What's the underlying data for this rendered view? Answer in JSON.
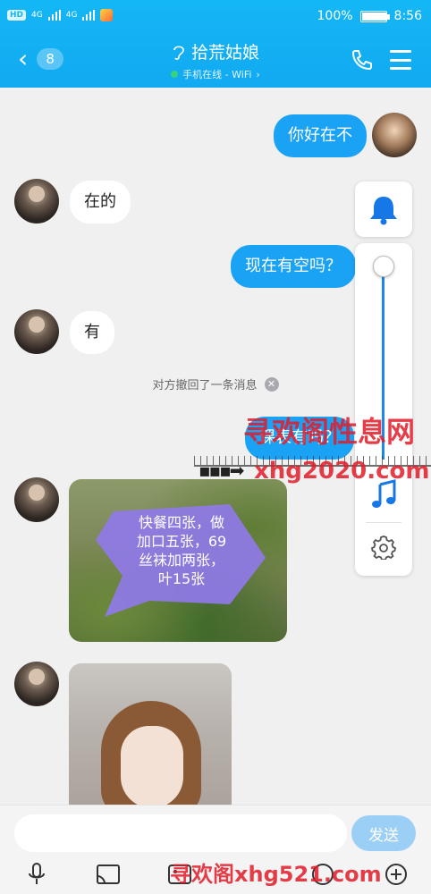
{
  "status_bar": {
    "carrier_chip": "HD",
    "signal_1": "4G",
    "signal_2": "4G",
    "battery_percent": "100%",
    "battery_level": 1.0,
    "time": "8:56"
  },
  "header": {
    "unread_count": "8",
    "title": "拾荒姑娘",
    "subtitle": "手机在线 - WiFi",
    "subtitle_chevron": "›"
  },
  "messages": [
    {
      "side": "out",
      "type": "text",
      "text": "你好在不"
    },
    {
      "side": "in",
      "type": "text",
      "text": "在的"
    },
    {
      "side": "out",
      "type": "text",
      "text": "现在有空吗？"
    },
    {
      "side": "in",
      "type": "text",
      "text": "有"
    },
    {
      "side": "system",
      "type": "notice",
      "text": "对方撤回了一条消息"
    },
    {
      "side": "out",
      "type": "text",
      "text": "课表有吗？"
    },
    {
      "side": "in",
      "type": "image",
      "caption_lines": [
        "快餐四张，做",
        "加口五张，69",
        "丝袜加两张，",
        "叶15张"
      ]
    },
    {
      "side": "in",
      "type": "image",
      "caption_lines": []
    }
  ],
  "float_panel": {
    "volume_level": 1.0
  },
  "watermarks": {
    "top_text": "寻欢阁性息网",
    "mid_text": "xhg2020.com",
    "bottom_text": "寻欢阁xhg521.com"
  },
  "input": {
    "value": "",
    "send_label": "发送"
  },
  "colors": {
    "header_bg": "#14b7f5",
    "bubble_out": "#1aa2f5",
    "watermark_red": "#e11d2a",
    "send_disabled": "#9ccff6"
  }
}
